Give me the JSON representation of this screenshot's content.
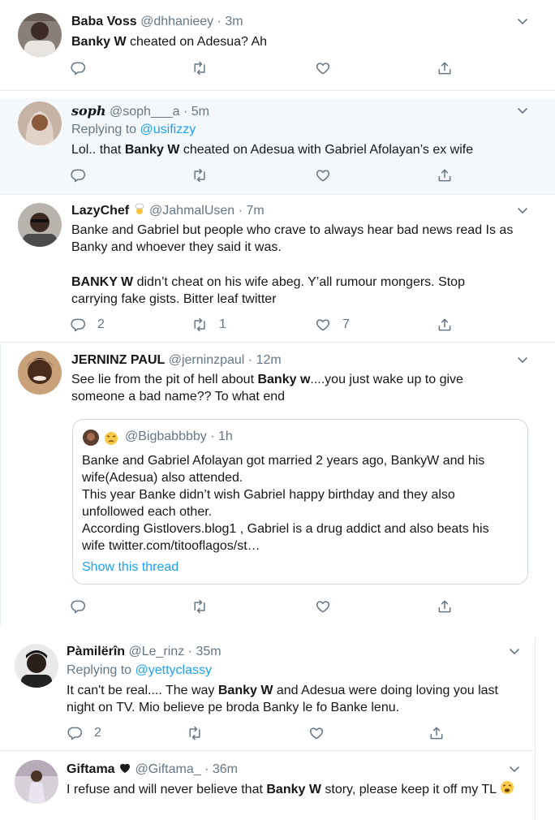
{
  "tweets": [
    {
      "name": "Baba Voss",
      "handle": "@dhhanieey",
      "dot": "·",
      "time": "3m",
      "text_pre": "",
      "text_bold": "Banky W",
      "text_post": " cheated on Adesua? Ah"
    },
    {
      "name": "𝒔𝒐𝒑𝒉",
      "handle": "@soph___a",
      "dot": "·",
      "time": "5m",
      "replying_prefix": "Replying to ",
      "replying_to": "@usifizzy",
      "text_pre": "Lol.. that ",
      "text_bold": "Banky W",
      "text_post": " cheated on Adesua with Gabriel Afolayan’s ex wife"
    },
    {
      "name": "LazyChef",
      "handle": "@JahmalUsen",
      "dot": "·",
      "time": "7m",
      "para1": "Banke and Gabriel but people who crave to always hear bad news read Is as Banky and whoever they said it was.",
      "text_bold": "BANKY W",
      "text_post": " didn’t cheat on his wife abeg. Y’all rumour mongers. Stop carrying fake gists. Bitter leaf twitter",
      "replies": "2",
      "retweets": "1",
      "likes": "7"
    },
    {
      "name": "JERNINZ PAUL",
      "handle": "@jerninzpaul",
      "dot": "·",
      "time": "12m",
      "text_pre": "See lie from the pit of hell about ",
      "text_bold": "Banky w",
      "text_post": "....you just wake up to give someone a bad name?? To what end",
      "quote": {
        "handle": "@Bigbabbbby",
        "dot": "·",
        "time": "1h",
        "line1": "Banke and Gabriel Afolayan got married 2 years ago, BankyW and his wife(Adesua) also attended.",
        "line2": "This year Banke didn’t wish Gabriel happy birthday and they also unfollowed each other.",
        "line3": "According Gistlovers.blog1 , Gabriel is a drug addict and also beats his wife twitter.com/titooflagos/st…",
        "show_thread": "Show this thread"
      }
    },
    {
      "name": "Pàmilërîn",
      "handle": "@Le_rinz",
      "dot": "·",
      "time": "35m",
      "replying_prefix": "Replying to ",
      "replying_to": "@yettyclassy",
      "text_pre": "It can't be real.... The way ",
      "text_bold": "Banky W",
      "text_post": " and Adesua were doing loving you last night on TV. Mio believe pe broda Banky le fo Banke lenu.",
      "replies": "2"
    },
    {
      "name": "Giftama",
      "handle": "@Giftama_",
      "dot": "·",
      "time": "36m",
      "text_pre": "I refuse and will never believe that ",
      "text_bold": "Banky W",
      "text_post": " story, please keep it off my TL"
    }
  ],
  "icons": {
    "reply": "reply-icon",
    "retweet": "retweet-icon",
    "like": "heart-icon",
    "share": "share-icon",
    "more": "chevron-down-icon"
  },
  "colors": {
    "accent": "#1da1f2",
    "secondary_text": "#657786",
    "divider": "#e6ecf0",
    "shaded_bg": "#f5f8fa"
  }
}
